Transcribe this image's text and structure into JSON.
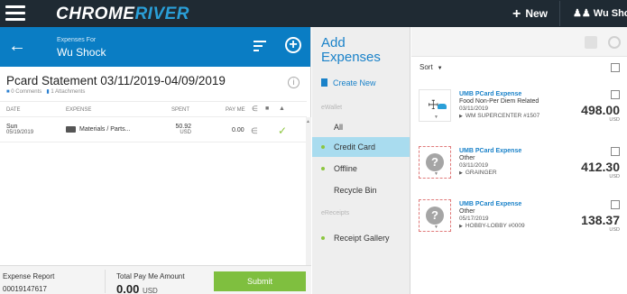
{
  "topbar": {
    "logo_part1": "CHROME",
    "logo_part2": "RIVER",
    "new_label": "New",
    "user_label": "Wu Shock"
  },
  "report": {
    "header_small": "Expenses For",
    "header_name": "Wu Shock",
    "title": "Pcard Statement 03/11/2019-04/09/2019",
    "comments": "0 Comments",
    "attachments": "1 Attachments",
    "columns": [
      "DATE",
      "EXPENSE",
      "SPENT",
      "PAY ME"
    ],
    "rows": [
      {
        "day": "Sun",
        "date": "05/19/2019",
        "expense": "Materials / Parts...",
        "spent": "50.92",
        "currency": "USD",
        "pay_me": "0.00"
      }
    ],
    "footer": {
      "report_label": "Expense Report",
      "report_id": "00019147617",
      "total_label": "Total Pay Me Amount",
      "total_value": "0.00",
      "total_currency": "USD",
      "submit_label": "Submit"
    }
  },
  "add_panel": {
    "title_line1": "Add",
    "title_line2": "Expenses",
    "create_new": "Create New",
    "ewallet_heading": "eWallet",
    "nav_all": "All",
    "nav_credit": "Credit Card",
    "nav_offline": "Offline",
    "nav_recycle": "Recycle Bin",
    "ereceipts_heading": "eReceipts",
    "nav_gallery": "Receipt Gallery"
  },
  "list": {
    "sort_label": "Sort",
    "items": [
      {
        "source": "UMB PCard Expense",
        "type": "Food Non-Per Diem Related",
        "date": "03/11/2019",
        "merchant": "WM SUPERCENTER #1507",
        "amount": "498.00",
        "currency": "USD"
      },
      {
        "source": "UMB PCard Expense",
        "type": "Other",
        "date": "03/11/2019",
        "merchant": "GRAINGER",
        "amount": "412.30",
        "currency": "USD"
      },
      {
        "source": "UMB PCard Expense",
        "type": "Other",
        "date": "05/17/2019",
        "merchant": "HOBBY-LOBBY #0009",
        "amount": "138.37",
        "currency": "USD"
      }
    ]
  },
  "colors": {
    "topbar": "#1f2a33",
    "header_blue": "#0a7dc4",
    "link_blue": "#1a82c9",
    "submit_green": "#7fbf3f",
    "selected_nav": "#a9dcef"
  }
}
